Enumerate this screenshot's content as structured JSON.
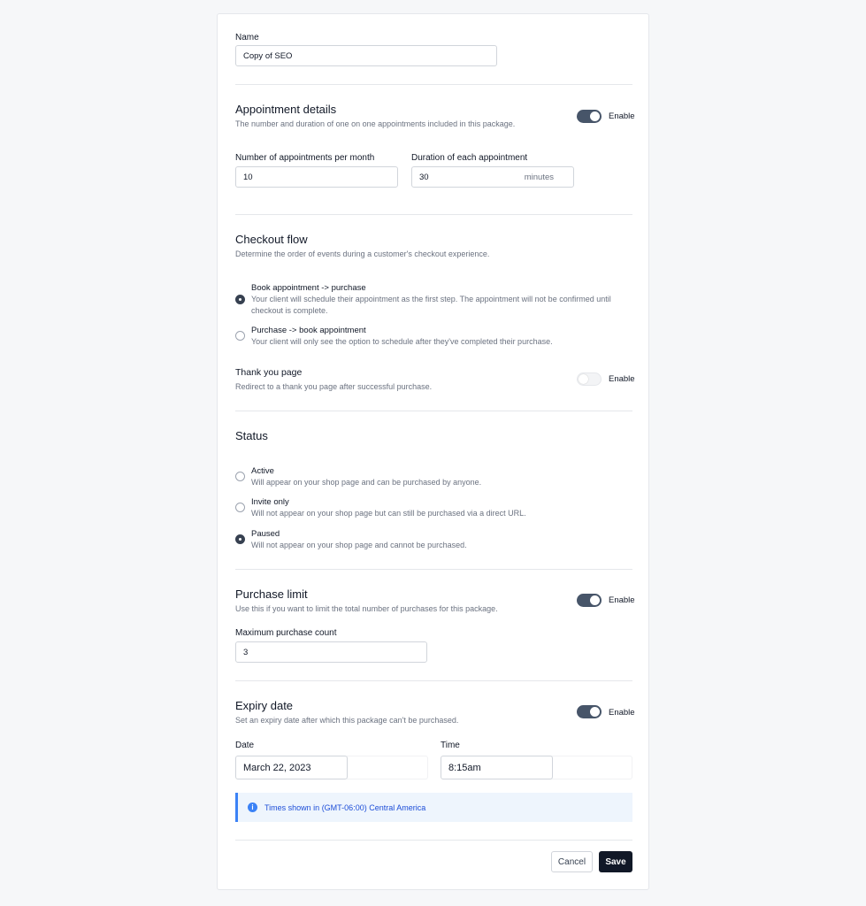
{
  "name_section": {
    "label": "Name",
    "value": "Copy of SEO"
  },
  "appointment_details": {
    "title": "Appointment details",
    "description": "The number and duration of one on one appointments included in this package.",
    "toggle_label": "Enable",
    "enabled": true,
    "appointments_label": "Number of appointments per month",
    "appointments_value": "10",
    "duration_label": "Duration of each appointment",
    "duration_value": "30",
    "duration_suffix": "minutes"
  },
  "checkout_flow": {
    "title": "Checkout flow",
    "description": "Determine the order of events during a customer's checkout experience.",
    "options": [
      {
        "title": "Book appointment -> purchase",
        "description": "Your client will schedule their appointment as the first step. The appointment will not be confirmed until checkout is complete.",
        "checked": true
      },
      {
        "title": "Purchase -> book appointment",
        "description": "Your client will only see the option to schedule after they've completed their purchase.",
        "checked": false
      }
    ]
  },
  "thank_you": {
    "title": "Thank you page",
    "description": "Redirect to a thank you page after successful purchase.",
    "toggle_label": "Enable",
    "enabled": false
  },
  "status": {
    "title": "Status",
    "options": [
      {
        "title": "Active",
        "description": "Will appear on your shop page and can be purchased by anyone.",
        "checked": false
      },
      {
        "title": "Invite only",
        "description": "Will not appear on your shop page but can still be purchased via a direct URL.",
        "checked": false
      },
      {
        "title": "Paused",
        "description": "Will not appear on your shop page and cannot be purchased.",
        "checked": true
      }
    ]
  },
  "purchase_limit": {
    "title": "Purchase limit",
    "description": "Use this if you want to limit the total number of purchases for this package.",
    "toggle_label": "Enable",
    "enabled": true,
    "max_label": "Maximum purchase count",
    "max_value": "3"
  },
  "expiry": {
    "title": "Expiry date",
    "description": "Set an expiry date after which this package can't be purchased.",
    "toggle_label": "Enable",
    "enabled": true,
    "date_label": "Date",
    "date_value": "March 22, 2023",
    "time_label": "Time",
    "time_value": "8:15am",
    "info_text": "Times shown in (GMT-06:00) Central America"
  },
  "actions": {
    "cancel_label": "Cancel",
    "save_label": "Save"
  },
  "colors": {
    "toggle_on": "#475569",
    "save_button": "#111827",
    "info_accent": "#3b82f6",
    "radio_checked": "#374151"
  }
}
